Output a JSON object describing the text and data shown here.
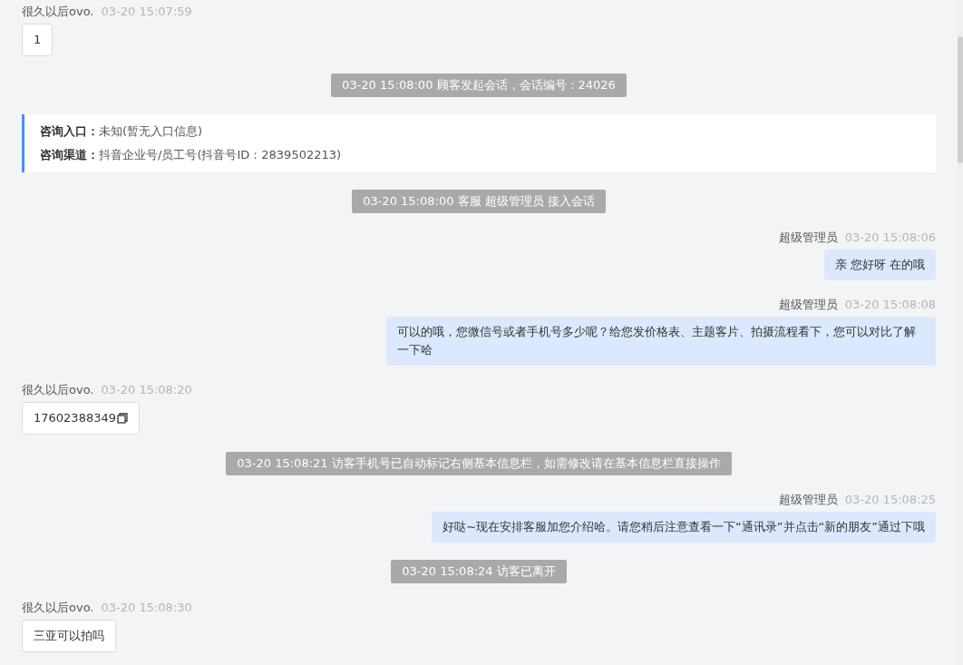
{
  "messages": [
    {
      "kind": "visitor",
      "sender": "很久以后ovo.",
      "time": "03-20 15:07:59",
      "text": "1",
      "copyable": false
    },
    {
      "kind": "system",
      "text": "03-20 15:08:00 顾客发起会话，会话编号：24026"
    },
    {
      "kind": "info",
      "fields": [
        {
          "label": "咨询入口：",
          "value": "未知(暂无入口信息)"
        },
        {
          "label": "咨询渠道：",
          "value": "抖音企业号/员工号(抖音号ID：2839502213)"
        }
      ]
    },
    {
      "kind": "system",
      "text": "03-20 15:08:00 客服 超级管理员 接入会话"
    },
    {
      "kind": "agent",
      "sender": "超级管理员",
      "time": "03-20 15:08:06",
      "text": "亲 您好呀 在的哦"
    },
    {
      "kind": "agent",
      "sender": "超级管理员",
      "time": "03-20 15:08:08",
      "text": "可以的哦，您微信号或者手机号多少呢？给您发价格表、主题客片、拍摄流程看下，您可以对比了解一下哈"
    },
    {
      "kind": "visitor",
      "sender": "很久以后ovo.",
      "time": "03-20 15:08:20",
      "text": "17602388349",
      "copyable": true
    },
    {
      "kind": "system",
      "text": "03-20 15:08:21 访客手机号已自动标记右侧基本信息栏，如需修改请在基本信息栏直接操作"
    },
    {
      "kind": "agent",
      "sender": "超级管理员",
      "time": "03-20 15:08:25",
      "text": "好哒~现在安排客服加您介绍哈。请您稍后注意查看一下“通讯录”并点击“新的朋友”通过下哦"
    },
    {
      "kind": "system",
      "text": "03-20 15:08:24 访客已离开"
    },
    {
      "kind": "visitor",
      "sender": "很久以后ovo.",
      "time": "03-20 15:08:30",
      "text": "三亚可以拍吗",
      "copyable": false
    }
  ]
}
